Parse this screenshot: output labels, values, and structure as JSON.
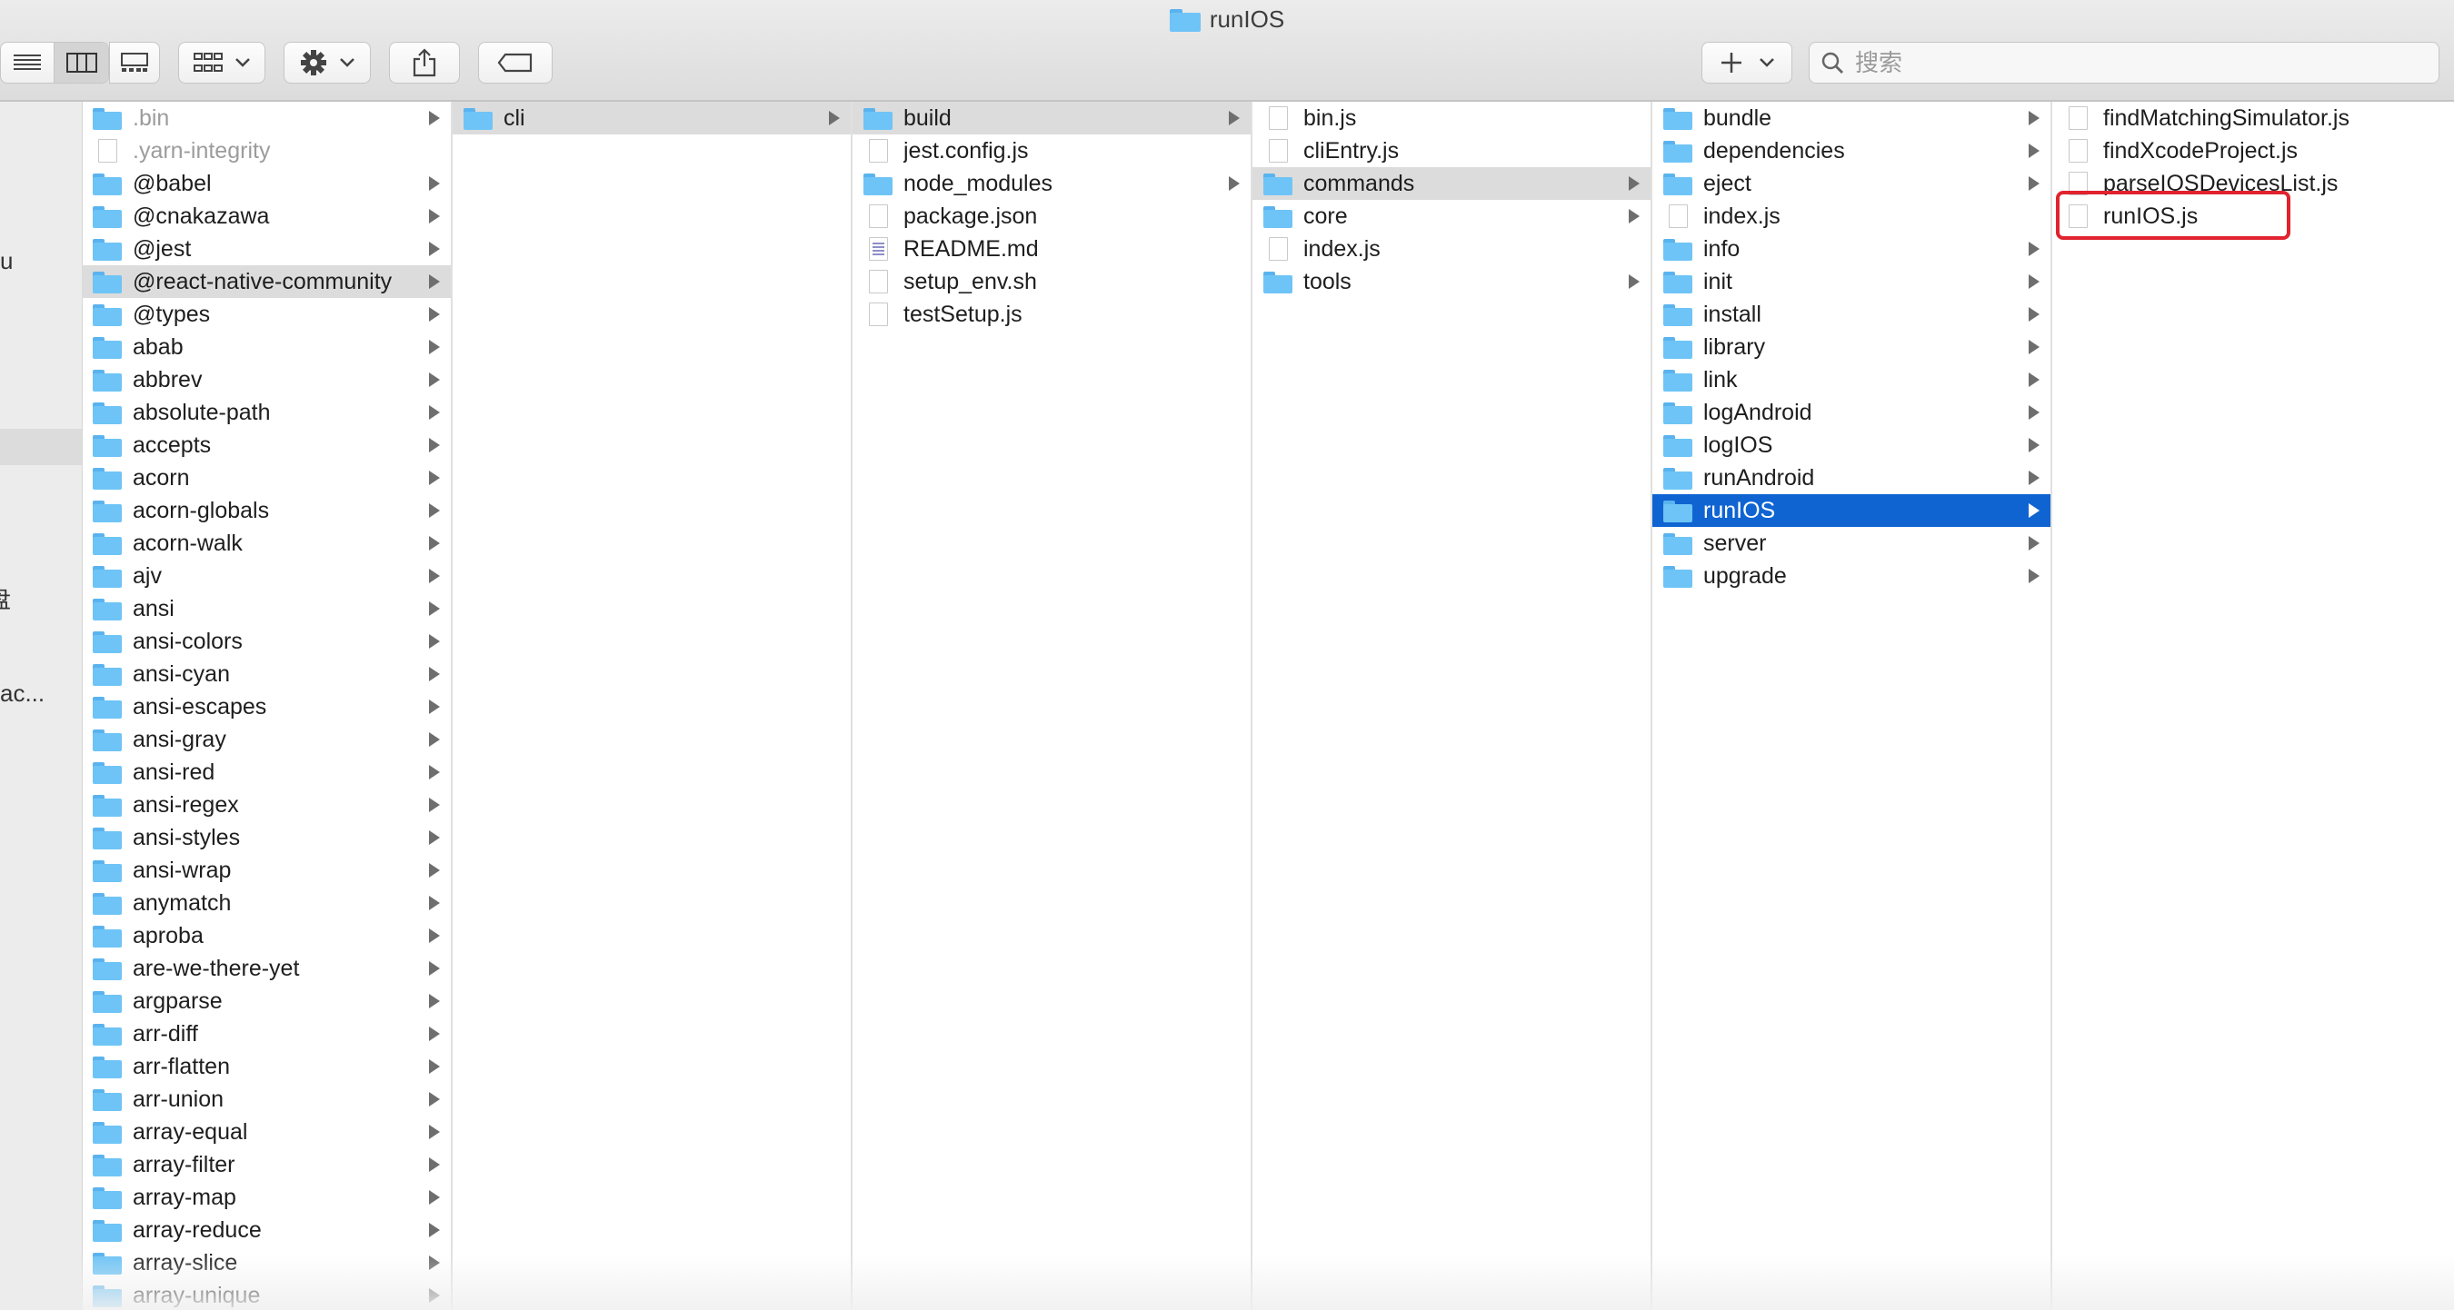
{
  "window": {
    "title": "runIOS",
    "title_icon": "folder-icon"
  },
  "toolbar": {
    "view_modes": [
      "list-view-icon",
      "column-view-icon",
      "gallery-view-icon"
    ],
    "group_icon": "grid-group-icon",
    "action_icon": "gear-icon",
    "share_icon": "share-icon",
    "tag_icon": "tag-icon",
    "add_icon": "plus-icon",
    "search": {
      "placeholder": "搜索",
      "value": ""
    }
  },
  "sidebar": {
    "fragments": [
      {
        "text": "u"
      },
      {
        "text": "盘"
      },
      {
        "text": "ac..."
      }
    ]
  },
  "columns": [
    {
      "items": [
        {
          "name": ".bin",
          "type": "folder",
          "has_children": true,
          "state": "dim"
        },
        {
          "name": ".yarn-integrity",
          "type": "file",
          "has_children": false,
          "state": "dim"
        },
        {
          "name": "@babel",
          "type": "folder",
          "has_children": true
        },
        {
          "name": "@cnakazawa",
          "type": "folder",
          "has_children": true
        },
        {
          "name": "@jest",
          "type": "folder",
          "has_children": true
        },
        {
          "name": "@react-native-community",
          "type": "folder",
          "has_children": true,
          "state": "selected-gray"
        },
        {
          "name": "@types",
          "type": "folder",
          "has_children": true
        },
        {
          "name": "abab",
          "type": "folder",
          "has_children": true
        },
        {
          "name": "abbrev",
          "type": "folder",
          "has_children": true
        },
        {
          "name": "absolute-path",
          "type": "folder",
          "has_children": true
        },
        {
          "name": "accepts",
          "type": "folder",
          "has_children": true
        },
        {
          "name": "acorn",
          "type": "folder",
          "has_children": true
        },
        {
          "name": "acorn-globals",
          "type": "folder",
          "has_children": true
        },
        {
          "name": "acorn-walk",
          "type": "folder",
          "has_children": true
        },
        {
          "name": "ajv",
          "type": "folder",
          "has_children": true
        },
        {
          "name": "ansi",
          "type": "folder",
          "has_children": true
        },
        {
          "name": "ansi-colors",
          "type": "folder",
          "has_children": true
        },
        {
          "name": "ansi-cyan",
          "type": "folder",
          "has_children": true
        },
        {
          "name": "ansi-escapes",
          "type": "folder",
          "has_children": true
        },
        {
          "name": "ansi-gray",
          "type": "folder",
          "has_children": true
        },
        {
          "name": "ansi-red",
          "type": "folder",
          "has_children": true
        },
        {
          "name": "ansi-regex",
          "type": "folder",
          "has_children": true
        },
        {
          "name": "ansi-styles",
          "type": "folder",
          "has_children": true
        },
        {
          "name": "ansi-wrap",
          "type": "folder",
          "has_children": true
        },
        {
          "name": "anymatch",
          "type": "folder",
          "has_children": true
        },
        {
          "name": "aproba",
          "type": "folder",
          "has_children": true
        },
        {
          "name": "are-we-there-yet",
          "type": "folder",
          "has_children": true
        },
        {
          "name": "argparse",
          "type": "folder",
          "has_children": true
        },
        {
          "name": "arr-diff",
          "type": "folder",
          "has_children": true
        },
        {
          "name": "arr-flatten",
          "type": "folder",
          "has_children": true
        },
        {
          "name": "arr-union",
          "type": "folder",
          "has_children": true
        },
        {
          "name": "array-equal",
          "type": "folder",
          "has_children": true
        },
        {
          "name": "array-filter",
          "type": "folder",
          "has_children": true
        },
        {
          "name": "array-map",
          "type": "folder",
          "has_children": true
        },
        {
          "name": "array-reduce",
          "type": "folder",
          "has_children": true
        },
        {
          "name": "array-slice",
          "type": "folder",
          "has_children": true
        },
        {
          "name": "array-unique",
          "type": "folder",
          "has_children": true
        }
      ]
    },
    {
      "items": [
        {
          "name": "cli",
          "type": "folder",
          "has_children": true,
          "state": "selected-gray"
        }
      ]
    },
    {
      "items": [
        {
          "name": "build",
          "type": "folder",
          "has_children": true,
          "state": "selected-gray"
        },
        {
          "name": "jest.config.js",
          "type": "file",
          "has_children": false
        },
        {
          "name": "node_modules",
          "type": "folder",
          "has_children": true
        },
        {
          "name": "package.json",
          "type": "file",
          "has_children": false
        },
        {
          "name": "README.md",
          "type": "file-md",
          "has_children": false
        },
        {
          "name": "setup_env.sh",
          "type": "file",
          "has_children": false
        },
        {
          "name": "testSetup.js",
          "type": "file",
          "has_children": false
        }
      ]
    },
    {
      "items": [
        {
          "name": "bin.js",
          "type": "file",
          "has_children": false
        },
        {
          "name": "cliEntry.js",
          "type": "file",
          "has_children": false
        },
        {
          "name": "commands",
          "type": "folder",
          "has_children": true,
          "state": "selected-gray"
        },
        {
          "name": "core",
          "type": "folder",
          "has_children": true
        },
        {
          "name": "index.js",
          "type": "file",
          "has_children": false
        },
        {
          "name": "tools",
          "type": "folder",
          "has_children": true
        }
      ]
    },
    {
      "items": [
        {
          "name": "bundle",
          "type": "folder",
          "has_children": true
        },
        {
          "name": "dependencies",
          "type": "folder",
          "has_children": true
        },
        {
          "name": "eject",
          "type": "folder",
          "has_children": true
        },
        {
          "name": "index.js",
          "type": "file",
          "has_children": false
        },
        {
          "name": "info",
          "type": "folder",
          "has_children": true
        },
        {
          "name": "init",
          "type": "folder",
          "has_children": true
        },
        {
          "name": "install",
          "type": "folder",
          "has_children": true
        },
        {
          "name": "library",
          "type": "folder",
          "has_children": true
        },
        {
          "name": "link",
          "type": "folder",
          "has_children": true
        },
        {
          "name": "logAndroid",
          "type": "folder",
          "has_children": true
        },
        {
          "name": "logIOS",
          "type": "folder",
          "has_children": true
        },
        {
          "name": "runAndroid",
          "type": "folder",
          "has_children": true
        },
        {
          "name": "runIOS",
          "type": "folder",
          "has_children": true,
          "state": "selected-blue"
        },
        {
          "name": "server",
          "type": "folder",
          "has_children": true
        },
        {
          "name": "upgrade",
          "type": "folder",
          "has_children": true
        }
      ]
    },
    {
      "items": [
        {
          "name": "findMatchingSimulator.js",
          "type": "file",
          "has_children": false
        },
        {
          "name": "findXcodeProject.js",
          "type": "file",
          "has_children": false
        },
        {
          "name": "parseIOSDevicesList.js",
          "type": "file",
          "has_children": false
        },
        {
          "name": "runIOS.js",
          "type": "file",
          "has_children": false,
          "annotated": true
        }
      ]
    }
  ],
  "colors": {
    "selection_blue": "#0f64d2",
    "selection_gray": "#dcdcdc",
    "annotation_red": "#e0232e",
    "folder_blue": "#6ec4f6"
  }
}
